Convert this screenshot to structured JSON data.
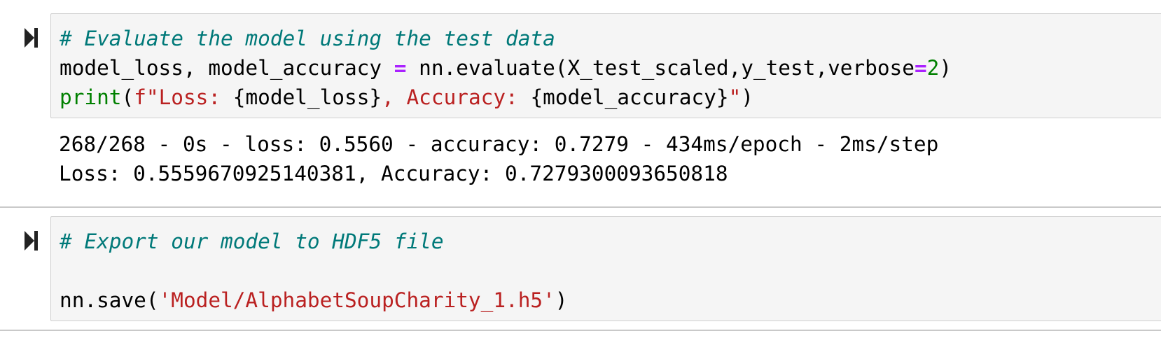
{
  "cells": [
    {
      "code": {
        "line1_comment": "# Evaluate the model using the test data",
        "line2_lhs": "model_loss, model_accuracy ",
        "line2_eq": "=",
        "line2_call_pre": " nn.evaluate(X_test_scaled,y_test,verbose",
        "line2_eq2": "=",
        "line2_num": "2",
        "line2_close": ")",
        "line3_fn": "print",
        "line3_open": "(",
        "line3_str1": "f\"Loss: ",
        "line3_var1": "{model_loss}",
        "line3_str2": ", Accuracy: ",
        "line3_var2": "{model_accuracy}",
        "line3_str3": "\"",
        "line3_close": ")"
      },
      "output": {
        "line1": "268/268 - 0s - loss: 0.5560 - accuracy: 0.7279 - 434ms/epoch - 2ms/step",
        "line2": "Loss: 0.5559670925140381, Accuracy: 0.7279300093650818"
      }
    },
    {
      "code": {
        "line1_comment": "# Export our model to HDF5 file",
        "line3_pre": "nn.save(",
        "line3_str": "'Model/AlphabetSoupCharity_1.h5'",
        "line3_close": ")"
      }
    }
  ],
  "icons": {
    "run": "run-cell-icon"
  }
}
